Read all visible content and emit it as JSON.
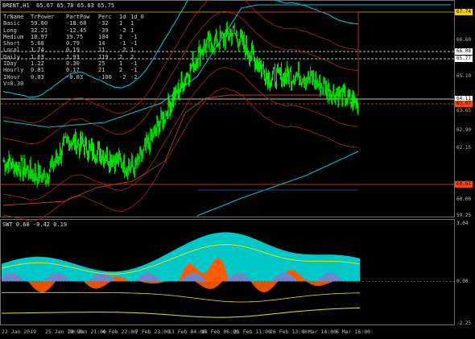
{
  "header": {
    "symbol": "BRENT,H1",
    "ohlc": "65.67 65.78 65.63 65.75"
  },
  "table": {
    "columns": [
      "TrName",
      "TrPower",
      "PartPow",
      "Perc",
      "1d",
      "1d_0"
    ],
    "rows": [
      [
        "Basic",
        "59.00",
        "-18.68",
        "-32",
        "1",
        "1"
      ],
      [
        "Long",
        "32.21",
        "-12.45",
        "-39",
        "-2",
        "1"
      ],
      [
        "Medium",
        "18.97",
        "19.75",
        "104",
        "2",
        "-1"
      ],
      [
        "Short",
        "5.68",
        "0.79",
        "14",
        "-1",
        "-1"
      ],
      [
        "Local",
        "1.74",
        "0.19",
        "11",
        "-2",
        "1"
      ],
      [
        "Daily",
        "1.63",
        "1.93",
        "119",
        "2",
        "2"
      ],
      [
        "IDay",
        "1.22",
        "0.30",
        "25",
        "1",
        "-1"
      ],
      [
        "Hourly",
        "0.81",
        "0.17",
        "21",
        "2",
        "-1"
      ],
      [
        "IHour",
        "0.03",
        "-0.03",
        "-100",
        "-2",
        "-2"
      ]
    ],
    "footer": "V=0.30"
  },
  "sub": {
    "label": "SWT 0.60 -0.42 0.19",
    "ticks": [
      "3.04",
      "0.00",
      "-2.25"
    ]
  },
  "price_ticks": [
    "68.05",
    "66.60",
    "65.10",
    "63.65",
    "62.90",
    "62.15",
    "60.70",
    "60.00",
    "59.25"
  ],
  "price_tags": [
    {
      "label": "67.74",
      "color": "#f0d000"
    },
    {
      "label": "66.08",
      "color": "#ffffff"
    },
    {
      "label": "65.77",
      "color": "#ffffff"
    },
    {
      "label": "64.11",
      "color": "#ffffff"
    },
    {
      "label": "63.97",
      "color": "#ff4500"
    },
    {
      "label": "60.61",
      "color": "#ff4500"
    }
  ],
  "x_labels": [
    "22 Jan 2019",
    "25 Jan 19:00",
    "30 Jan 21:00",
    "4 Feb 22:00",
    "7 Feb 23:00",
    "13 Feb 04:00",
    "18 Feb 06:00",
    "21 Feb 11:00",
    "26 Feb 13:00",
    "1 Mar 14:00",
    "6 Mar 16:00"
  ],
  "chart_data": [
    {
      "type": "line",
      "title": "BRENT,H1",
      "xlabel": "",
      "ylabel": "",
      "ylim": [
        59.25,
        68.3
      ],
      "categories": [
        "22 Jan 2019",
        "25 Jan 19:00",
        "30 Jan 21:00",
        "4 Feb 22:00",
        "7 Feb 23:00",
        "13 Feb 04:00",
        "18 Feb 06:00",
        "21 Feb 11:00",
        "26 Feb 13:00",
        "1 Mar 14:00",
        "6 Mar 16:00"
      ],
      "series": [
        {
          "values": [
            61.6,
            60.9,
            62.5,
            61.9,
            61.3,
            63.9,
            66.4,
            67.1,
            65.2,
            65.3,
            64.0
          ]
        }
      ],
      "colors": {
        "price": "#00ff00",
        "envelope": "#00bcd4",
        "bands": "#c0392b",
        "levels": "#e0c000"
      },
      "grid": false
    },
    {
      "type": "area",
      "title": "SWT 0.60 -0.42 0.19",
      "ylim": [
        -2.25,
        3.04
      ],
      "colors": {
        "cyan": "#00c8c8",
        "orange": "#ff5a00",
        "blue": "#6e86c8",
        "yellow": "#e6e600"
      }
    }
  ]
}
